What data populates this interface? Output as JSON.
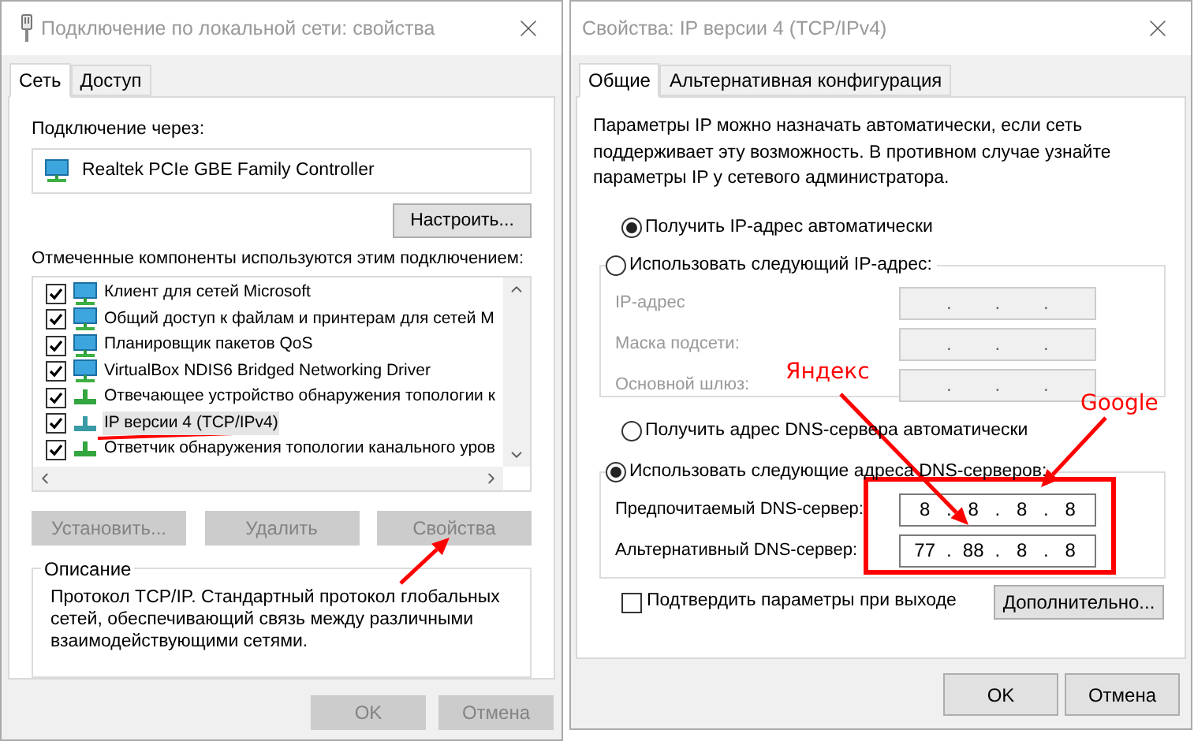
{
  "left_dialog": {
    "title": "Подключение по локальной сети: свойства",
    "tabs": [
      {
        "label": "Сеть",
        "selected": true
      },
      {
        "label": "Доступ",
        "selected": false
      }
    ],
    "connect_label": "Подключение через:",
    "adapter": "Realtek PCIe GBE Family Controller",
    "configure_button": "Настроить...",
    "components_label": "Отмеченные компоненты используются этим подключением:",
    "components": [
      {
        "label": "Клиент для сетей Microsoft",
        "kind": "network",
        "checked": true,
        "selected": false
      },
      {
        "label": "Общий доступ к файлам и принтерам для сетей M",
        "kind": "network",
        "checked": true,
        "selected": false
      },
      {
        "label": "Планировщик пакетов QoS",
        "kind": "network",
        "checked": true,
        "selected": false
      },
      {
        "label": "VirtualBox NDIS6 Bridged Networking Driver",
        "kind": "network",
        "checked": true,
        "selected": false
      },
      {
        "label": "Отвечающее устройство обнаружения топологии к",
        "kind": "protocol",
        "checked": true,
        "selected": false
      },
      {
        "label": "IP версии 4 (TCP/IPv4)",
        "kind": "protocol",
        "checked": true,
        "selected": true
      },
      {
        "label": "Ответчик обнаружения топологии канального уров",
        "kind": "protocol",
        "checked": true,
        "selected": false
      }
    ],
    "buttons": [
      {
        "label": "Установить...",
        "disabled": true
      },
      {
        "label": "Удалить",
        "disabled": true
      },
      {
        "label": "Свойства",
        "disabled": true
      }
    ],
    "description": {
      "title": "Описание",
      "text": "Протокол TCP/IP. Стандартный протокол глобальных сетей, обеспечивающий связь между различными взаимодействующими сетями."
    },
    "footer_buttons": [
      {
        "label": "OK",
        "disabled": true
      },
      {
        "label": "Отмена",
        "disabled": true
      }
    ]
  },
  "right_dialog": {
    "title": "Свойства: IP версии 4 (TCP/IPv4)",
    "tabs": [
      {
        "label": "Общие",
        "selected": true
      },
      {
        "label": "Альтернативная конфигурация",
        "selected": false
      }
    ],
    "intro": "Параметры IP можно назначать автоматически, если сеть поддерживает эту возможность. В противном случае узнайте параметры IP у сетевого администратора.",
    "ip_separator": ".",
    "ip_auto": {
      "label": "Получить IP-адрес автоматически",
      "selected": true
    },
    "ip_manual": {
      "label": "Использовать следующий IP-адрес:",
      "selected": false,
      "fields": [
        {
          "label": "IP-адрес",
          "disabled": true
        },
        {
          "label": "Маска подсети:",
          "disabled": true
        },
        {
          "label": "Основной шлюз:",
          "disabled": true
        }
      ]
    },
    "dns_auto": {
      "label": "Получить адрес DNS-сервера автоматически",
      "selected": false
    },
    "dns_manual": {
      "label": "Использовать следующие адреса DNS-серверов:",
      "selected": true,
      "fields": [
        {
          "label": "Предпочитаемый DNS-сервер:",
          "disabled": false,
          "octets": [
            "8",
            "8",
            "8",
            "8"
          ]
        },
        {
          "label": "Альтернативный DNS-сервер:",
          "disabled": false,
          "octets": [
            "77",
            "88",
            "8",
            "8"
          ]
        }
      ]
    },
    "confirm": {
      "label": "Подтвердить параметры при выходе",
      "checked": false
    },
    "advanced_button": "Дополнительно...",
    "footer_buttons": [
      {
        "label": "OK",
        "disabled": false
      },
      {
        "label": "Отмена",
        "disabled": false
      }
    ]
  },
  "annotations": [
    {
      "text": "Яндекс"
    },
    {
      "text": "Google"
    }
  ]
}
